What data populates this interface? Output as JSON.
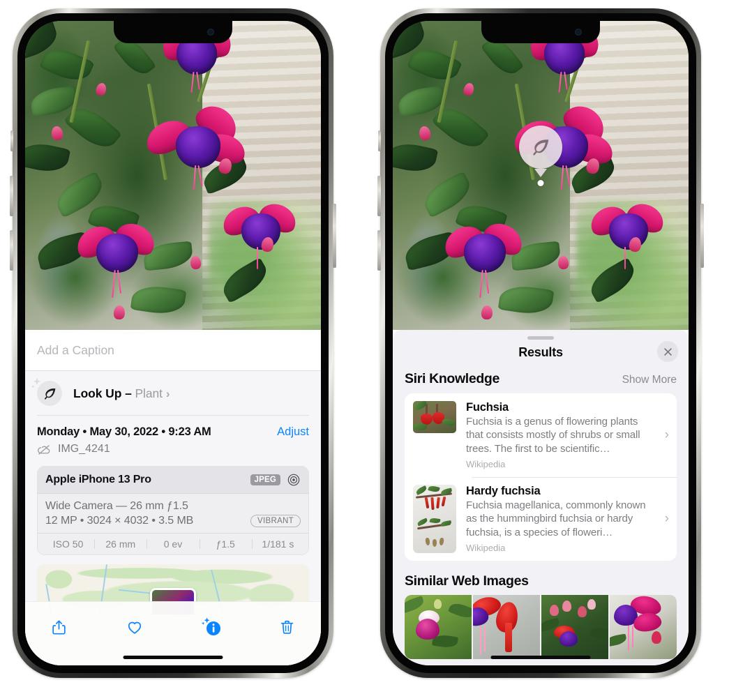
{
  "app": {
    "name": "Photos",
    "accent_color": "#0a84ff"
  },
  "left_phone": {
    "label": "iPhone showing Photos info panel",
    "photo": {
      "alt_name": "fuchsia-flowers-photo"
    },
    "caption_field": {
      "placeholder": "Add a Caption",
      "value": ""
    },
    "lookup_row": {
      "icon": "leaf-icon",
      "sparkle_icon": "sparkle-icon",
      "label": "Look Up",
      "dash": "–",
      "subject": "Plant",
      "chevron": "›"
    },
    "date_row": {
      "date": "Monday • May 30, 2022 • 9:23 AM",
      "adjust_label": "Adjust"
    },
    "file_row": {
      "icon": "cloud-slash-icon",
      "filename": "IMG_4241"
    },
    "camera_card": {
      "device": "Apple iPhone 13 Pro",
      "format_chip": "JPEG",
      "aperture_icon": "aperture-icon",
      "lens_line": "Wide Camera — 26 mm ƒ1.5",
      "specs_line": "12 MP • 3024 × 4032 • 3.5 MB",
      "style_chip": "VIBRANT",
      "exif": [
        "ISO 50",
        "26 mm",
        "0 ev",
        "ƒ1.5",
        "1/181 s"
      ]
    },
    "map": {
      "name": "location-map"
    },
    "toolbar": {
      "share_label": "share-icon",
      "favorite_label": "heart-icon",
      "info_label": "info-sparkle-icon",
      "delete_label": "trash-icon"
    }
  },
  "right_phone": {
    "label": "iPhone showing Visual Look Up results",
    "marker": {
      "icon": "leaf-icon"
    },
    "sheet": {
      "grabber": "drag-handle",
      "title": "Results",
      "close_icon": "close-icon"
    },
    "siri_knowledge": {
      "title": "Siri Knowledge",
      "show_more": "Show More",
      "cards": [
        {
          "title": "Fuchsia",
          "description": "Fuchsia is a genus of flowering plants that consists mostly of shrubs or small trees. The first to be scientific…",
          "source": "Wikipedia",
          "chevron": "›",
          "thumb": "fuchsia-red-flowers-thumbnail"
        },
        {
          "title": "Hardy fuchsia",
          "description": "Fuchsia magellanica, commonly known as the hummingbird fuchsia or hardy fuchsia, is a species of floweri…",
          "source": "Wikipedia",
          "chevron": "›",
          "thumb": "hardy-fuchsia-specimen-thumbnail"
        }
      ]
    },
    "similar_web_images": {
      "title": "Similar Web Images",
      "tiles": [
        "fuchsia-pink-white-bloom",
        "fuchsia-red-tube-closeup",
        "fuchsia-shrub-buds",
        "fuchsia-purple-red-bloom"
      ]
    }
  }
}
